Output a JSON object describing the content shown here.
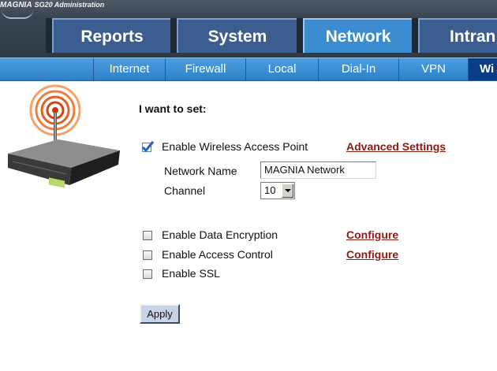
{
  "app": {
    "logo": "MAGNIA",
    "title": "SG20 Administration"
  },
  "tabs": [
    {
      "label": "Reports"
    },
    {
      "label": "System"
    },
    {
      "label": "Network",
      "active": true
    },
    {
      "label": "Intran"
    }
  ],
  "subnav": [
    {
      "label": "Internet"
    },
    {
      "label": "Firewall"
    },
    {
      "label": "Local"
    },
    {
      "label": "Dial-In"
    },
    {
      "label": "VPN"
    },
    {
      "label": "Wi",
      "active": true
    }
  ],
  "form": {
    "heading": "I want to set:",
    "wireless_ap": {
      "label": "Enable Wireless Access Point",
      "checked": true
    },
    "advanced_settings_link": "Advanced Settings",
    "network_name": {
      "label": "Network Name",
      "value": "MAGNIA Network"
    },
    "channel": {
      "label": "Channel",
      "value": "10"
    },
    "data_encryption": {
      "label": "Enable Data Encryption",
      "checked": false
    },
    "access_control": {
      "label": "Enable Access Control",
      "checked": false
    },
    "ssl": {
      "label": "Enable SSL",
      "checked": false
    },
    "configure_link": "Configure",
    "apply_label": "Apply"
  },
  "colors": {
    "header": "#3b4551",
    "tab": "#3c5d8f",
    "tab_active": "#3b8bd0",
    "subnav": "#3b90d8",
    "subnav_active": "#0a3d86",
    "link": "#8b1a12"
  },
  "icons": {
    "router": "router-icon",
    "check": "checkmark-icon",
    "dropdown": "chevron-down-icon"
  }
}
